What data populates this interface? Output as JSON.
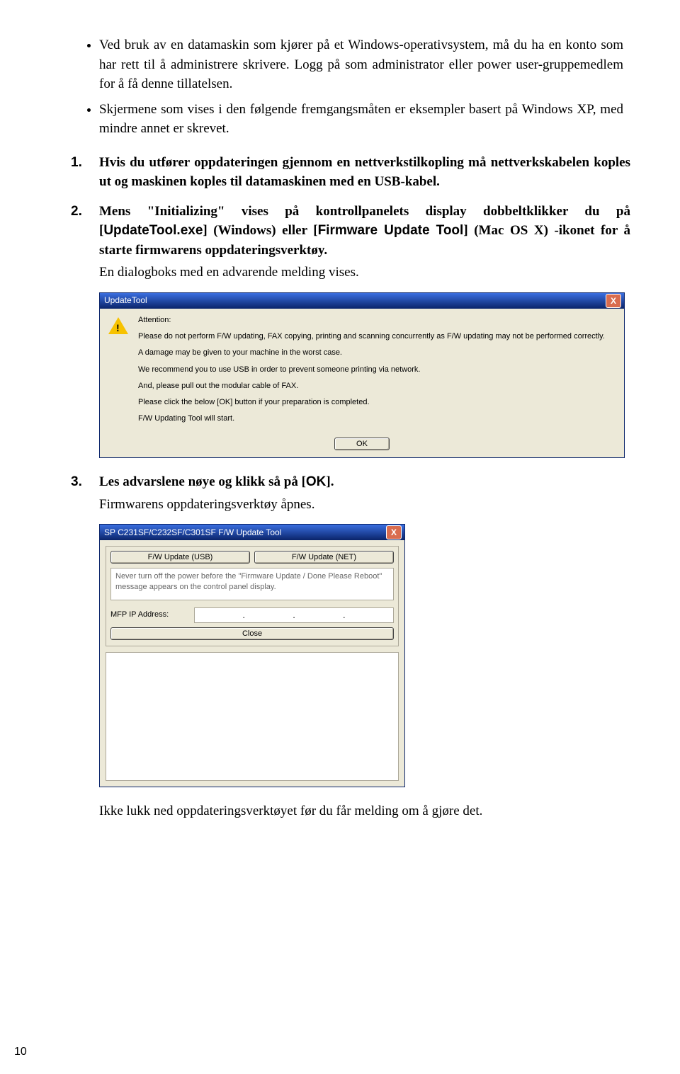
{
  "bullets": [
    "Ved bruk av en datamaskin som kjører på et Windows-operativsystem, må du ha en konto som har rett til å administrere skrivere. Logg på som administrator eller power user-gruppemedlem for å få denne tillatelsen.",
    "Skjermene som vises i den følgende fremgangsmåten er eksempler basert på Windows XP, med mindre annet er skrevet."
  ],
  "steps": {
    "s1": {
      "num": "1.",
      "text_a": "Hvis du utfører oppdateringen gjennom en nettverkstilkopling må nettverkskabelen koples ut og maskinen koples til datamaskinen med en USB-kabel."
    },
    "s2": {
      "num": "2.",
      "text_a": "Mens \"Initializing\" vises på kontrollpanelets display dobbeltklikker du på [",
      "sans_a": "UpdateTool.exe",
      "text_b": "] (Windows) eller [",
      "sans_b": "Firmware Update Tool",
      "text_c": "] (Mac OS X) -ikonet for å starte firmwarens oppdateringsverktøy.",
      "sub": "En dialogboks med en advarende melding vises."
    },
    "s3": {
      "num": "3.",
      "text_a": "Les advarslene nøye og klikk så på [",
      "sans_a": "OK",
      "text_b": "].",
      "sub": "Firmwarens oppdateringsverktøy åpnes."
    }
  },
  "dialog1": {
    "title": "UpdateTool",
    "attention": "Attention:",
    "lines": [
      "Please do not perform F/W updating, FAX copying, printing and scanning concurrently as F/W updating may not be performed correctly.",
      "A damage may be given to your machine in the worst case.",
      "We recommend you to use USB in order to prevent someone printing via network.",
      "And, please pull out the modular cable of FAX.",
      "Please click the below [OK] button if your preparation is completed.",
      "F/W Updating Tool will start."
    ],
    "ok": "OK"
  },
  "dialog2": {
    "title": "SP C231SF/C232SF/C301SF F/W Update Tool",
    "btn_usb": "F/W Update (USB)",
    "btn_net": "F/W Update (NET)",
    "info": "Never turn off the power before the \"Firmware Update / Done Please Reboot\" message appears on the control panel display.",
    "ip_label": "MFP IP Address:",
    "ip_dots": ".",
    "close": "Close"
  },
  "final_text": "Ikke lukk ned oppdateringsverktøyet før du får melding om å gjøre det.",
  "page_number": "10",
  "close_x": "X"
}
